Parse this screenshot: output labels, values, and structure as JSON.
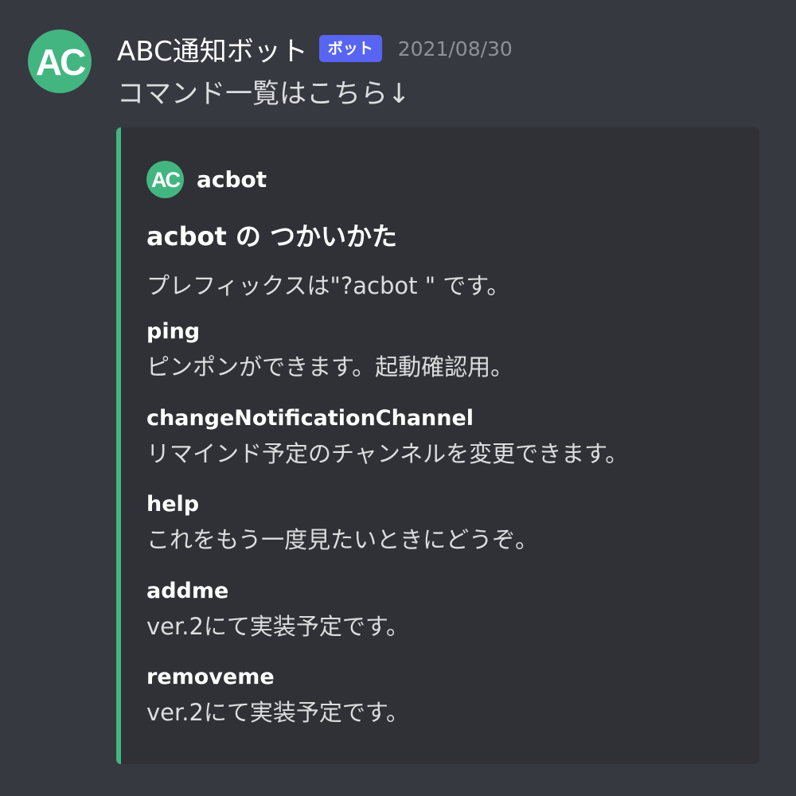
{
  "message": {
    "avatar_text": "AC",
    "username": "ABC通知ボット",
    "bot_tag": "ボット",
    "timestamp": "2021/08/30",
    "content": "コマンド一覧はこちら↓"
  },
  "embed": {
    "author_icon_text": "AC",
    "author_name": "acbot",
    "title": "acbot の つかいかた",
    "description": "プレフィックスは\"?acbot \" です。",
    "fields": [
      {
        "name": "ping",
        "value": "ピンポンができます。起動確認用。"
      },
      {
        "name": "changeNotificationChannel",
        "value": "リマインド予定のチャンネルを変更できます。"
      },
      {
        "name": "help",
        "value": "これをもう一度見たいときにどうぞ。"
      },
      {
        "name": "addme",
        "value": "ver.2にて実装予定です。"
      },
      {
        "name": "removeme",
        "value": "ver.2にて実装予定です。"
      }
    ]
  },
  "colors": {
    "background": "#36393f",
    "embed_background": "#2f3136",
    "accent_green": "#43b581",
    "bot_tag": "#5865f2"
  }
}
